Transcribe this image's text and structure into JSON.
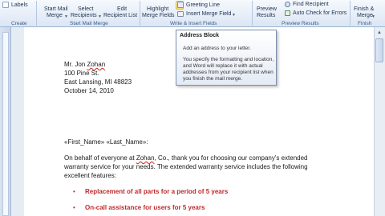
{
  "ribbon": {
    "labels_button": "Labels",
    "create_group": "Create",
    "start_mail_merge": {
      "line1": "Start Mail",
      "line2": "Merge"
    },
    "select_recipients": {
      "line1": "Select",
      "line2": "Recipients"
    },
    "edit_recipient_list": {
      "line1": "Edit",
      "line2": "Recipient List"
    },
    "start_mail_merge_group": "Start Mail Merge",
    "highlight_merge_fields": {
      "line1": "Highlight",
      "line2": "Merge Fields"
    },
    "greeting_line": "Greeting Line",
    "insert_merge_field": "Insert Merge Field",
    "write_insert_group": "Write & Insert Fields",
    "preview_results": {
      "line1": "Preview",
      "line2": "Results"
    },
    "find_recipient": "Find Recipient",
    "auto_check": "Auto Check for Errors",
    "preview_group": "Preview Results",
    "finish_merge": {
      "line1": "Finish &",
      "line2": "Merge"
    },
    "finish_group": "Finish"
  },
  "tooltip": {
    "title": "Address Block",
    "line1": "Add an address to your letter.",
    "line2": "You specify the formatting and location, and Word will replace it with actual addresses from your recipient list when you finish the mail merge."
  },
  "document": {
    "addr_name_prefix": "Mr. Jon ",
    "addr_name_surname": "Zohan",
    "addr_street": "100 Pine St.",
    "addr_city": "East Lansing, MI 48823",
    "addr_date": "October 14, 2010",
    "greeting": "«First_Name» «Last_Name»:",
    "body1_prefix": "On behalf of everyone at ",
    "body1_company": "Zohan",
    "body1_suffix": ", Co., thank you for choosing our company's extended",
    "body2": "warranty service for your needs. The extended warranty service includes the following",
    "body3": "excellent features:",
    "bullets": [
      "Replacement of all parts for a period of 5 years",
      "On-call assistance for users for 5 years"
    ],
    "bullet_char": "•"
  },
  "colors": {
    "ribbon_top": "#f6f9fd",
    "ribbon_bottom": "#dbe6f4",
    "bullet_red": "#c0282b",
    "group_label": "#3b5a86"
  }
}
